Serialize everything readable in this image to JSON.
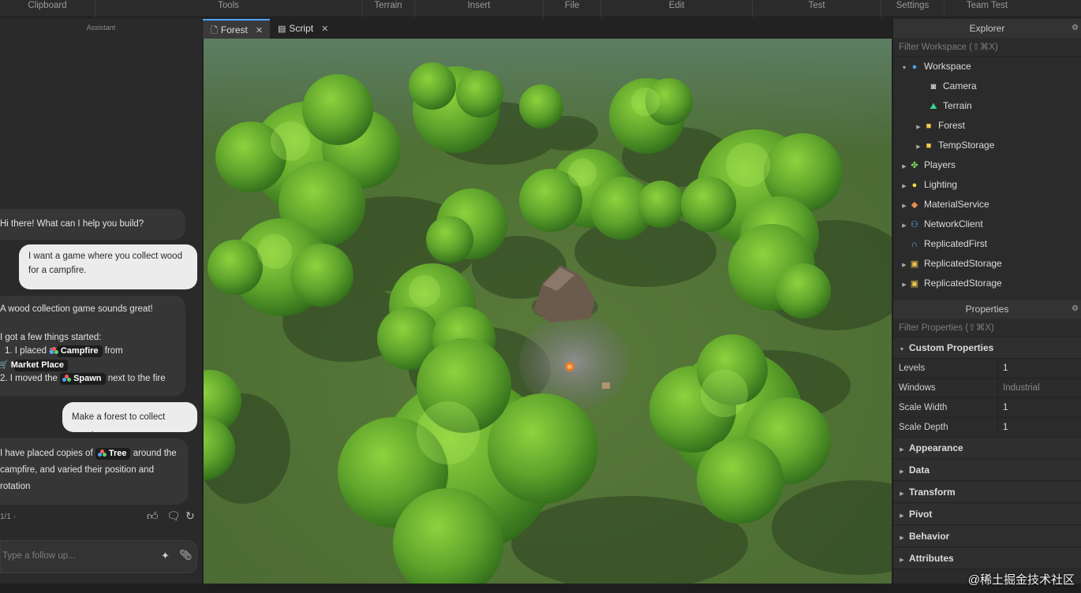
{
  "ribbon": {
    "groups": [
      "Clipboard",
      "Tools",
      "Terrain",
      "Insert",
      "File",
      "Edit",
      "Test",
      "Settings",
      "Team Test"
    ]
  },
  "assistant": {
    "title": "Assistant",
    "messages": {
      "greeting": "Hi there! What can I help you build?",
      "user1": "I want a game where you collect wood for a campfire.",
      "bot2_intro": "A wood collection game sounds great!",
      "bot2_started": "I got a few things started:",
      "bot2_item1_pre": "1. I placed a",
      "campfire_chip": "Campfire",
      "bot2_item1_mid": "from",
      "marketplace_chip": "Market Place",
      "bot2_item2_pre": "2. I moved the",
      "spawn_chip": "Spawn",
      "bot2_item2_post": "next to the fire",
      "user2": "Make a forest to collect wood",
      "bot3_pre": "I have placed copies of",
      "tree_chip": "Tree",
      "bot3_post": "around the",
      "bot3_rest": "campfire, and varied their position and rotation"
    },
    "pager": "1/1",
    "input_placeholder": "Type a follow up..."
  },
  "tabs": [
    {
      "label": "Forest",
      "icon": "document-icon",
      "active": true
    },
    {
      "label": "Script",
      "icon": "script-icon",
      "active": false
    }
  ],
  "explorer": {
    "title": "Explorer",
    "filter": "Filter Workspace (⇧⌘X)",
    "items": [
      {
        "label": "Workspace",
        "icon": "globe-icon",
        "expanded": true
      },
      {
        "label": "Camera",
        "icon": "camera-icon"
      },
      {
        "label": "Terrain",
        "icon": "terrain-icon"
      },
      {
        "label": "Forest",
        "icon": "folder-icon"
      },
      {
        "label": "TempStorage",
        "icon": "folder-icon"
      },
      {
        "label": "Players",
        "icon": "players-icon"
      },
      {
        "label": "Lighting",
        "icon": "lightbulb-icon"
      },
      {
        "label": "MaterialService",
        "icon": "material-icon"
      },
      {
        "label": "NetworkClient",
        "icon": "network-icon"
      },
      {
        "label": "ReplicatedFirst",
        "icon": "replicated-first-icon"
      },
      {
        "label": "ReplicatedStorage",
        "icon": "replicated-storage-icon"
      },
      {
        "label": "ReplicatedStorage",
        "icon": "replicated-storage-icon"
      }
    ]
  },
  "properties": {
    "title": "Properties",
    "filter": "Filter Properties (⇧⌘X)",
    "custom_section": "Custom Properties",
    "rows": [
      {
        "key": "Levels",
        "value": "1"
      },
      {
        "key": "Windows",
        "value": "Industrial"
      },
      {
        "key": "Scale Width",
        "value": "1"
      },
      {
        "key": "Scale Depth",
        "value": "1"
      }
    ],
    "sections": [
      "Appearance",
      "Data",
      "Transform",
      "Pivot",
      "Behavior",
      "Attributes"
    ]
  },
  "watermark": "@稀土掘金技术社区",
  "colors": {
    "accent": "#4da3ff",
    "grass": "#5e7f3d",
    "foliage": "#6fae2f",
    "folder": "#f2c94c"
  }
}
